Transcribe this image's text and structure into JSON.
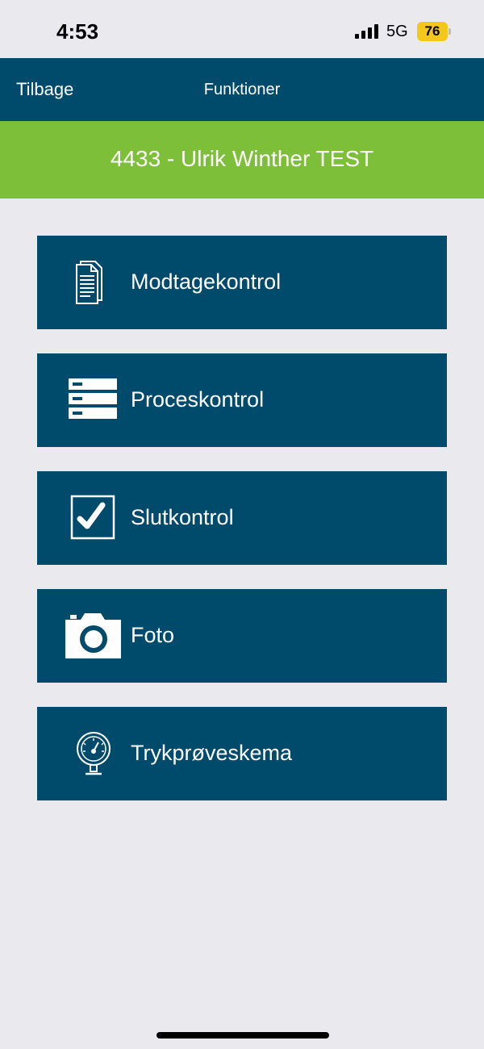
{
  "status_bar": {
    "time": "4:53",
    "network": "5G",
    "battery": "76",
    "battery_color": "#f3c81b"
  },
  "nav": {
    "back_label": "Tilbage",
    "title": "Funktioner"
  },
  "banner": {
    "text": "4433 - Ulrik Winther TEST",
    "color": "#7dbf38"
  },
  "menu": {
    "items": [
      {
        "label": "Modtagekontrol",
        "icon": "document-icon"
      },
      {
        "label": "Proceskontrol",
        "icon": "server-stack-icon"
      },
      {
        "label": "Slutkontrol",
        "icon": "checkbox-checked-icon"
      },
      {
        "label": "Foto",
        "icon": "camera-icon"
      },
      {
        "label": "Trykprøveskema",
        "icon": "pressure-gauge-icon"
      }
    ]
  },
  "colors": {
    "primary": "#004b6b",
    "background": "#e9e9ee"
  }
}
